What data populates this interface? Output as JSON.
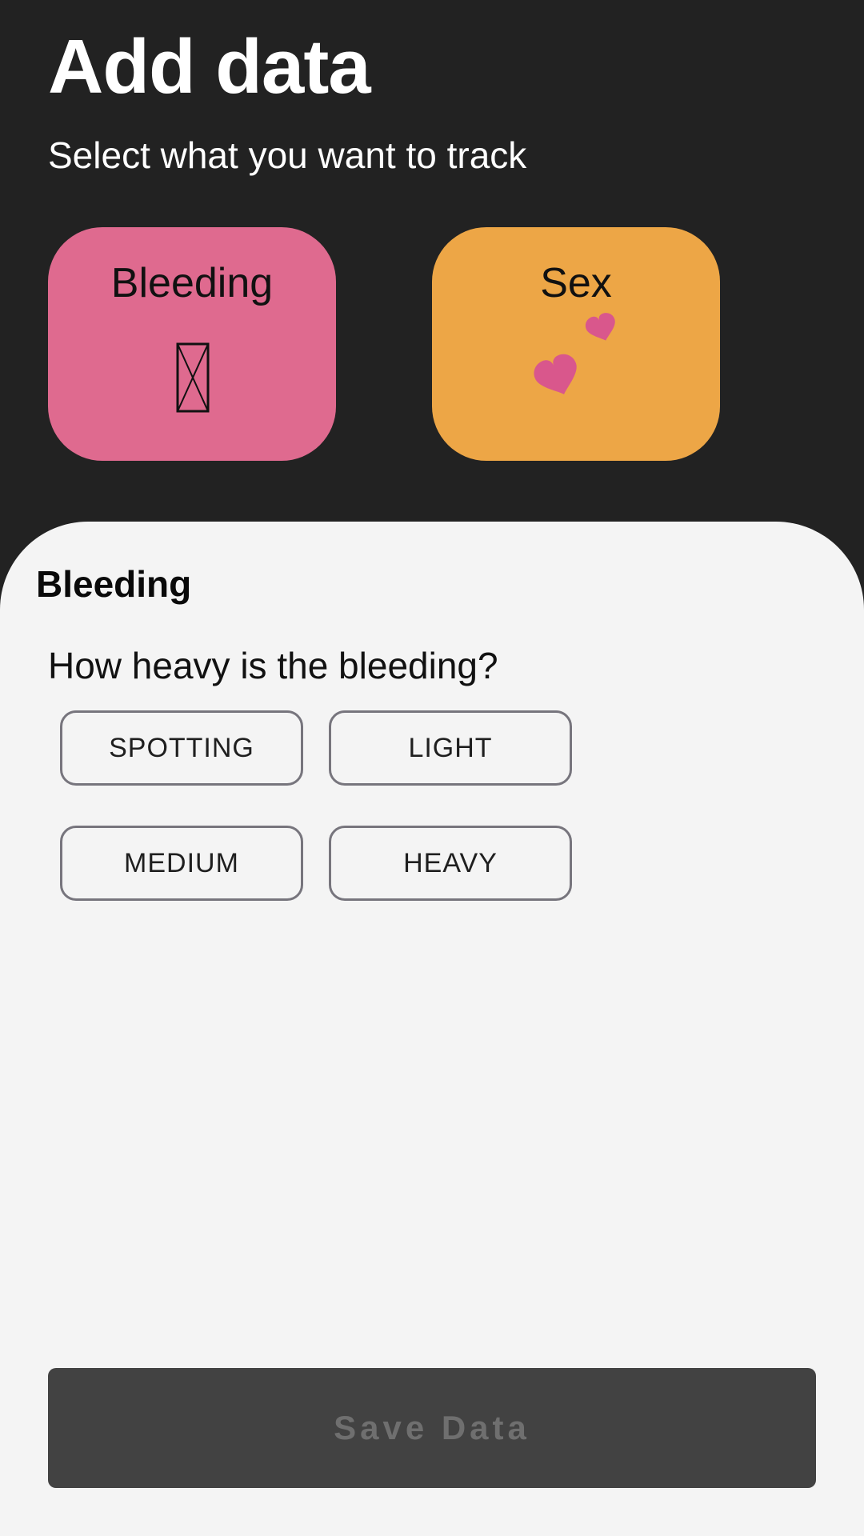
{
  "header": {
    "title": "Add data",
    "subtitle": "Select what you want to track"
  },
  "categories": [
    {
      "label": "Bleeding",
      "icon": "missing-glyph-icon",
      "color": "#df6a8f"
    },
    {
      "label": "Sex",
      "icon": "two-hearts-icon",
      "color": "#eda646"
    }
  ],
  "sheet": {
    "title": "Bleeding",
    "question": "How heavy is the bleeding?",
    "options": [
      "SPOTTING",
      "LIGHT",
      "MEDIUM",
      "HEAVY"
    ]
  },
  "save_button": {
    "label": "Save Data"
  },
  "colors": {
    "background": "#222222",
    "sheet": "#f4f4f4",
    "heart": "#d9578c",
    "save_button": "#424242"
  }
}
